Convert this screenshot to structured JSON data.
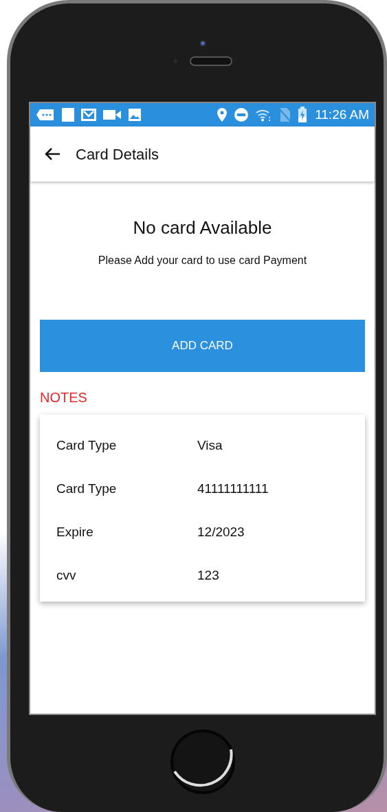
{
  "status_bar": {
    "time": "11:26 AM"
  },
  "app_bar": {
    "title": "Card Details"
  },
  "empty_state": {
    "title": "No card Available",
    "message": "Please Add your card to use card Payment"
  },
  "add_button": {
    "label": "ADD CARD"
  },
  "notes": {
    "heading": "NOTES",
    "rows": [
      {
        "label": "Card Type",
        "value": "Visa"
      },
      {
        "label": "Card Type",
        "value": "41111111111"
      },
      {
        "label": "Expire",
        "value": "12/2023"
      },
      {
        "label": "cvv",
        "value": "123"
      }
    ]
  }
}
